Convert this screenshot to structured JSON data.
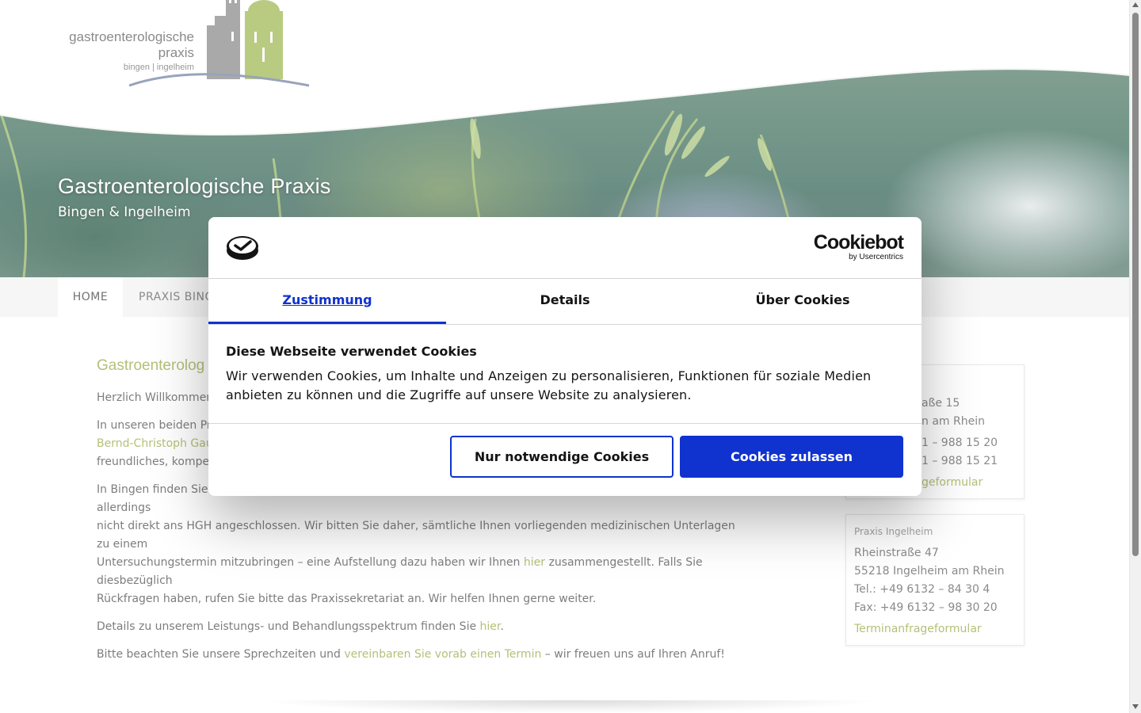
{
  "site": {
    "logo": {
      "line1": "gastroenterologische",
      "line2": "praxis",
      "line3": "bingen | ingelheim"
    },
    "hero": {
      "title": "Gastroenterologische Praxis",
      "subtitle": "Bingen & Ingelheim"
    },
    "nav": {
      "home": "HOME",
      "bingen": "PRAXIS BING"
    },
    "content": {
      "heading": "Gastroenterolog",
      "p1": "Herzlich Willkommen",
      "p2_a": "In unseren beiden Pra",
      "p2_link": "Bernd-Christoph Gaue",
      "p2_b": "freundliches, kompete",
      "p3_line1": "In Bingen finden Sie uns in den Räumlichkeiten des Heilig-Geist-Hospitals (HGH). Als eigenständige Praxis sind wir allerdings",
      "p3_line2": "nicht direkt ans HGH angeschlossen. Wir bitten Sie daher, sämtliche Ihnen vorliegenden medizinischen Unterlagen zu einem",
      "p3_line3_a": "Untersuchungstermin mitzubringen – eine Aufstellung dazu haben wir Ihnen ",
      "p3_link": "hier",
      "p3_line3_b": " zusammengestellt. Falls Sie diesbezüglich",
      "p3_line4": "Rückfragen haben, rufen Sie bitte das Praxissekretariat an. Wir helfen Ihnen gerne weiter.",
      "p4_a": "Details zu unserem Leistungs- und Behandlungsspektrum finden Sie ",
      "p4_link": "hier",
      "p4_b": ".",
      "p5_a": "Bitte beachten Sie unsere Sprechzeiten und ",
      "p5_link": "vereinbaren Sie vorab einen Termin",
      "p5_b": " – wir freuen uns auf Ihren Anruf!"
    },
    "box_bingen": {
      "street": "aße 15",
      "city": "n am Rhein",
      "tel": "1 – 988 15 20",
      "fax": "1 – 988 15 21",
      "link": "geformular"
    },
    "box_ingelheim": {
      "title": "Praxis Ingelheim",
      "street": "Rheinstraße 47",
      "city": "55218 Ingelheim am Rhein",
      "tel": "Tel.: +49 6132 – 84 30 4",
      "fax": "Fax: +49 6132 – 98 30 20",
      "link": "Terminanfrageformular"
    }
  },
  "cookie_dialog": {
    "brand": "Cookiebot",
    "brand_sub": "by Usercentrics",
    "tabs": [
      "Zustimmung",
      "Details",
      "Über Cookies"
    ],
    "active_tab": "Zustimmung",
    "heading": "Diese Webseite verwendet Cookies",
    "text": "Wir verwenden Cookies, um Inhalte und Anzeigen zu personalisieren, Funktionen für soziale Medien anbieten zu können und die Zugriffe auf unsere Website zu analysieren.",
    "btn_necessary": "Nur notwendige Cookies",
    "btn_allow": "Cookies zulassen",
    "accent_color": "#1032cf"
  },
  "colors": {
    "link_green": "#9aae4d"
  }
}
